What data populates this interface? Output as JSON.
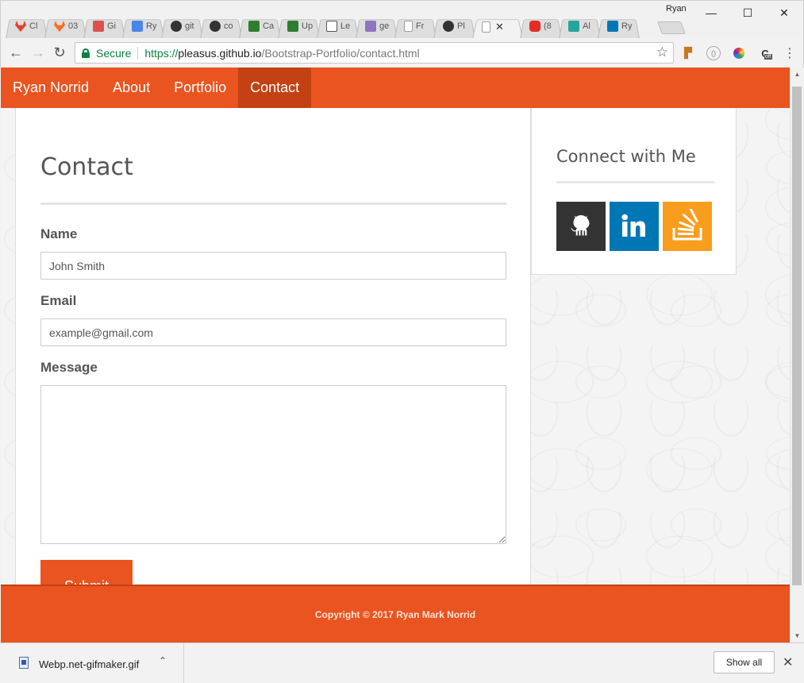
{
  "browser": {
    "profile_name": "Ryan",
    "tabs": [
      {
        "label": "Cl",
        "icon": "gitlab-icon",
        "color": "#e2432a"
      },
      {
        "label": "03",
        "icon": "gitlab-icon",
        "color": "#fc6d26"
      },
      {
        "label": "Gi",
        "icon": "film-icon",
        "color": "#d9534f"
      },
      {
        "label": "Ry",
        "icon": "docs-icon",
        "color": "#4a86e8"
      },
      {
        "label": "git",
        "icon": "github-icon",
        "color": "#333333"
      },
      {
        "label": "co",
        "icon": "github-icon",
        "color": "#333333"
      },
      {
        "label": "Ca",
        "icon": "android-icon",
        "color": "#2e7d32"
      },
      {
        "label": "Up",
        "icon": "android-icon",
        "color": "#2e7d32"
      },
      {
        "label": "Le",
        "icon": "code-icon",
        "color": "#555555"
      },
      {
        "label": "ge",
        "icon": "heroku-icon",
        "color": "#8e76bd"
      },
      {
        "label": "Fr",
        "icon": "page-icon",
        "color": "#9e9e9e"
      },
      {
        "label": "Pl",
        "icon": "github-icon",
        "color": "#333333"
      },
      {
        "label": "",
        "icon": "page-icon",
        "color": "#9e9e9e",
        "active": true
      },
      {
        "label": "(8",
        "icon": "youtube-icon",
        "color": "#e52d27"
      },
      {
        "label": "Al",
        "icon": "app-icon",
        "color": "#26a69a"
      },
      {
        "label": "Ry",
        "icon": "linkedin-icon",
        "color": "#0077b5"
      }
    ],
    "secure_label": "Secure",
    "url_scheme": "https://",
    "url_host": "pleasus.github.io",
    "url_path": "/Bootstrap-Portfolio/contact.html",
    "extension_badge": "off"
  },
  "site": {
    "brand": "Ryan Norrid",
    "nav": [
      "About",
      "Portfolio",
      "Contact"
    ],
    "active_nav": "Contact",
    "colors": {
      "primary": "#e95420",
      "active": "#c34113"
    }
  },
  "contact": {
    "title": "Contact",
    "name_label": "Name",
    "name_placeholder": "John Smith",
    "email_label": "Email",
    "email_placeholder": "example@gmail.com",
    "message_label": "Message",
    "submit_label": "Submit"
  },
  "sidebar": {
    "title": "Connect with Me",
    "links": [
      {
        "name": "github",
        "icon": "github-icon",
        "color": "#333333"
      },
      {
        "name": "linkedin",
        "icon": "linkedin-icon",
        "color": "#0077b5"
      },
      {
        "name": "stackoverflow",
        "icon": "stackoverflow-icon",
        "color": "#f99d1c"
      }
    ]
  },
  "footer": {
    "copyright": "Copyright © 2017 Ryan Mark Norrid"
  },
  "downloads": {
    "file_name": "Webp.net-gifmaker.gif",
    "show_all_label": "Show all"
  }
}
